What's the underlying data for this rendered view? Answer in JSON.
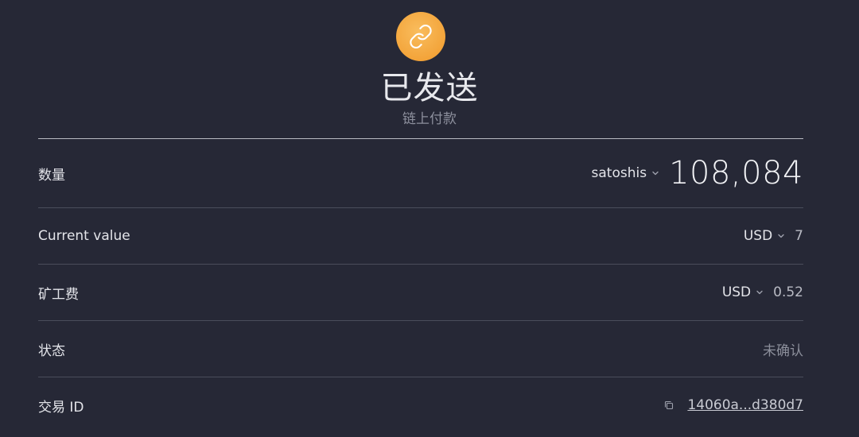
{
  "header": {
    "badge_icon": "link-icon",
    "badge_color": "#f3a43a",
    "title": "已发送",
    "subtitle": "链上付款"
  },
  "details": {
    "amount": {
      "label": "数量",
      "unit": "satoshis",
      "value": "108,084"
    },
    "current_value": {
      "label": "Current value",
      "currency": "USD",
      "value": "7"
    },
    "fee": {
      "label": "矿工费",
      "currency": "USD",
      "value": "0.52"
    },
    "status": {
      "label": "状态",
      "value": "未确认"
    },
    "tx_id": {
      "label": "交易 ID",
      "copy_icon": "copy-icon",
      "value": "14060a...d380d7"
    }
  }
}
